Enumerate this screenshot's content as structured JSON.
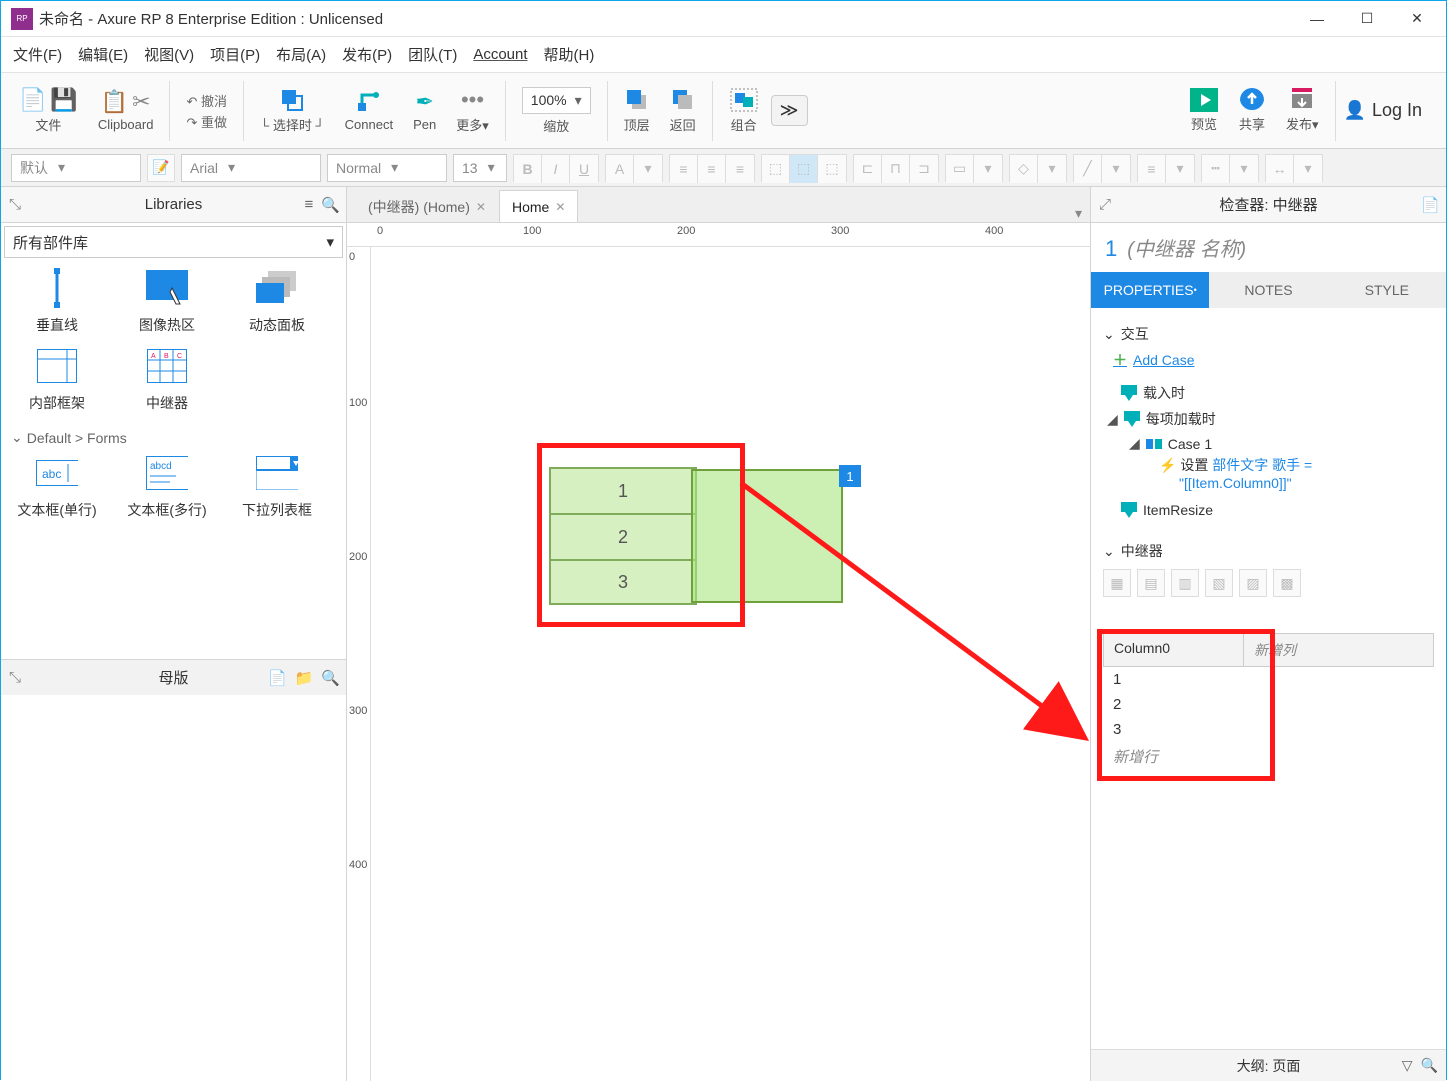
{
  "window": {
    "title": "未命名 - Axure RP 8 Enterprise Edition : Unlicensed"
  },
  "menu": {
    "file": "文件(F)",
    "edit": "编辑(E)",
    "view": "视图(V)",
    "project": "项目(P)",
    "layout": "布局(A)",
    "publish": "发布(P)",
    "team": "团队(T)",
    "account": "Account",
    "help": "帮助(H)"
  },
  "toolbar": {
    "file": "文件",
    "clipboard": "Clipboard",
    "undo": "撤消",
    "redo": "重做",
    "select": "选择时",
    "connect": "Connect",
    "pen": "Pen",
    "more": "更多",
    "zoom_value": "100%",
    "zoom_label": "缩放",
    "front": "顶层",
    "back": "返回",
    "group": "组合",
    "preview": "预览",
    "share": "共享",
    "publish": "发布",
    "login": "Log In"
  },
  "format": {
    "style": "默认",
    "font": "Arial",
    "weight": "Normal",
    "size": "13"
  },
  "left": {
    "libraries_title": "Libraries",
    "lib_select": "所有部件库",
    "items": {
      "vline": "垂直线",
      "hotspot": "图像热区",
      "dynamic": "动态面板",
      "iframe": "内部框架",
      "repeater": "中继器"
    },
    "section": "Default > Forms",
    "forms": {
      "textfield": "文本框(单行)",
      "textarea": "文本框(多行)",
      "droplist": "下拉列表框"
    },
    "masters_title": "母版"
  },
  "tabs": {
    "tab1": "(中继器) (Home)",
    "tab2": "Home"
  },
  "ruler": {
    "r0": "0",
    "r100": "100",
    "r200": "200",
    "r300": "300",
    "r400": "400"
  },
  "canvas": {
    "row1": "1",
    "row2": "2",
    "row3": "3",
    "badge": "1"
  },
  "inspector": {
    "header": "检查器: 中继器",
    "count": "1",
    "name": "(中继器 名称)",
    "tabs": {
      "props": "PROPERTIES",
      "notes": "NOTES",
      "style": "STYLE"
    },
    "section_interact": "交互",
    "add_case": "Add Case",
    "ev_load": "载入时",
    "ev_itemload": "每项加载时",
    "case1": "Case 1",
    "action_label": "设置 ",
    "action_target": "部件文字 歌手 = ",
    "action_value": "\"[[Item.Column0]]\"",
    "ev_resize": "ItemResize",
    "section_repeater": "中继器",
    "col0": "Column0",
    "add_col": "新增列",
    "d1": "1",
    "d2": "2",
    "d3": "3",
    "add_row": "新增行",
    "outline": "大纲: 页面"
  }
}
